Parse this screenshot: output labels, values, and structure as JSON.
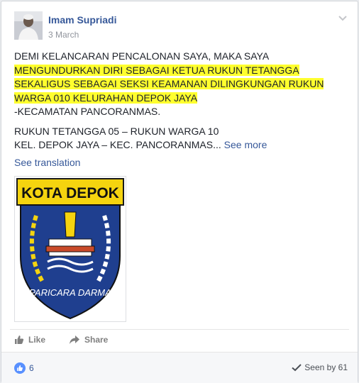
{
  "post": {
    "author": "Imam Supriadi",
    "date": "3 March",
    "lines": [
      "DEMI KELANCARAN PENCALONAN SAYA, MAKA SAYA",
      "MENGUNDURKAN DIRI SEBAGAI KETUA RUKUN TETANGGA",
      "SEKALIGUS SEBAGAI SEKSI KEAMANAN DILINGKUNGAN RUKUN",
      "WARGA 010 KELURAHAN DEPOK JAYA",
      "-KECAMATAN PANCORANMAS.",
      "RUKUN TETANGGA 05 – RUKUN WARGA 10",
      "KEL. DEPOK JAYA – KEC. PANCORANMAS..."
    ],
    "see_more": "See more",
    "see_translation": "See translation"
  },
  "image": {
    "title": "KOTA DEPOK",
    "motto": "PARICARA DARMA"
  },
  "actions": {
    "like": "Like",
    "share": "Share"
  },
  "footer": {
    "like_count": "6",
    "seen_by": "Seen by 61"
  },
  "colors": {
    "link": "#365899",
    "highlight": "#ffff2e",
    "shield_blue": "#1f3f8f",
    "shield_yellow": "#f5d40f"
  }
}
